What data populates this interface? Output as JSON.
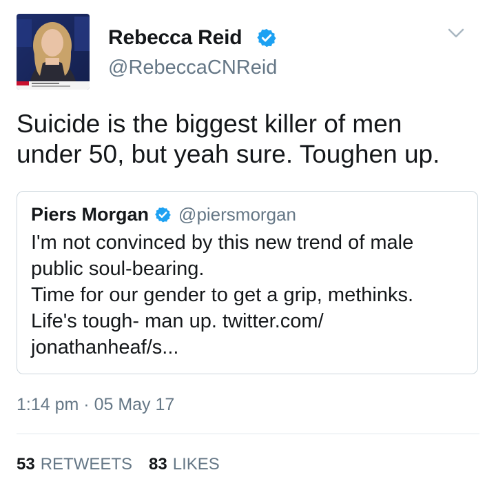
{
  "tweet": {
    "author": {
      "display_name": "Rebecca Reid",
      "handle": "@RebeccaCNReid",
      "verified": true,
      "avatar_icon": "profile-photo"
    },
    "text_lines": [
      "Suicide is the biggest killer of men",
      "under 50, but yeah sure. Toughen up."
    ],
    "quoted": {
      "display_name": "Piers Morgan",
      "handle": "@piersmorgan",
      "verified": true,
      "text_lines": [
        "I'm not convinced by this new trend of male",
        "public soul-bearing.",
        "Time for our gender to get a grip, methinks.",
        "Life's tough- man up. twitter.com/",
        "jonathanheaf/s..."
      ]
    },
    "time": "1:14 pm",
    "separator": "·",
    "date": "05 May 17",
    "stats": {
      "retweets_count": "53",
      "retweets_label": "RETWEETS",
      "likes_count": "83",
      "likes_label": "LIKES"
    }
  },
  "colors": {
    "verified_blue": "#1da1f2",
    "secondary_text": "#657786",
    "primary_text": "#14171a",
    "border": "#ccd6dd"
  }
}
